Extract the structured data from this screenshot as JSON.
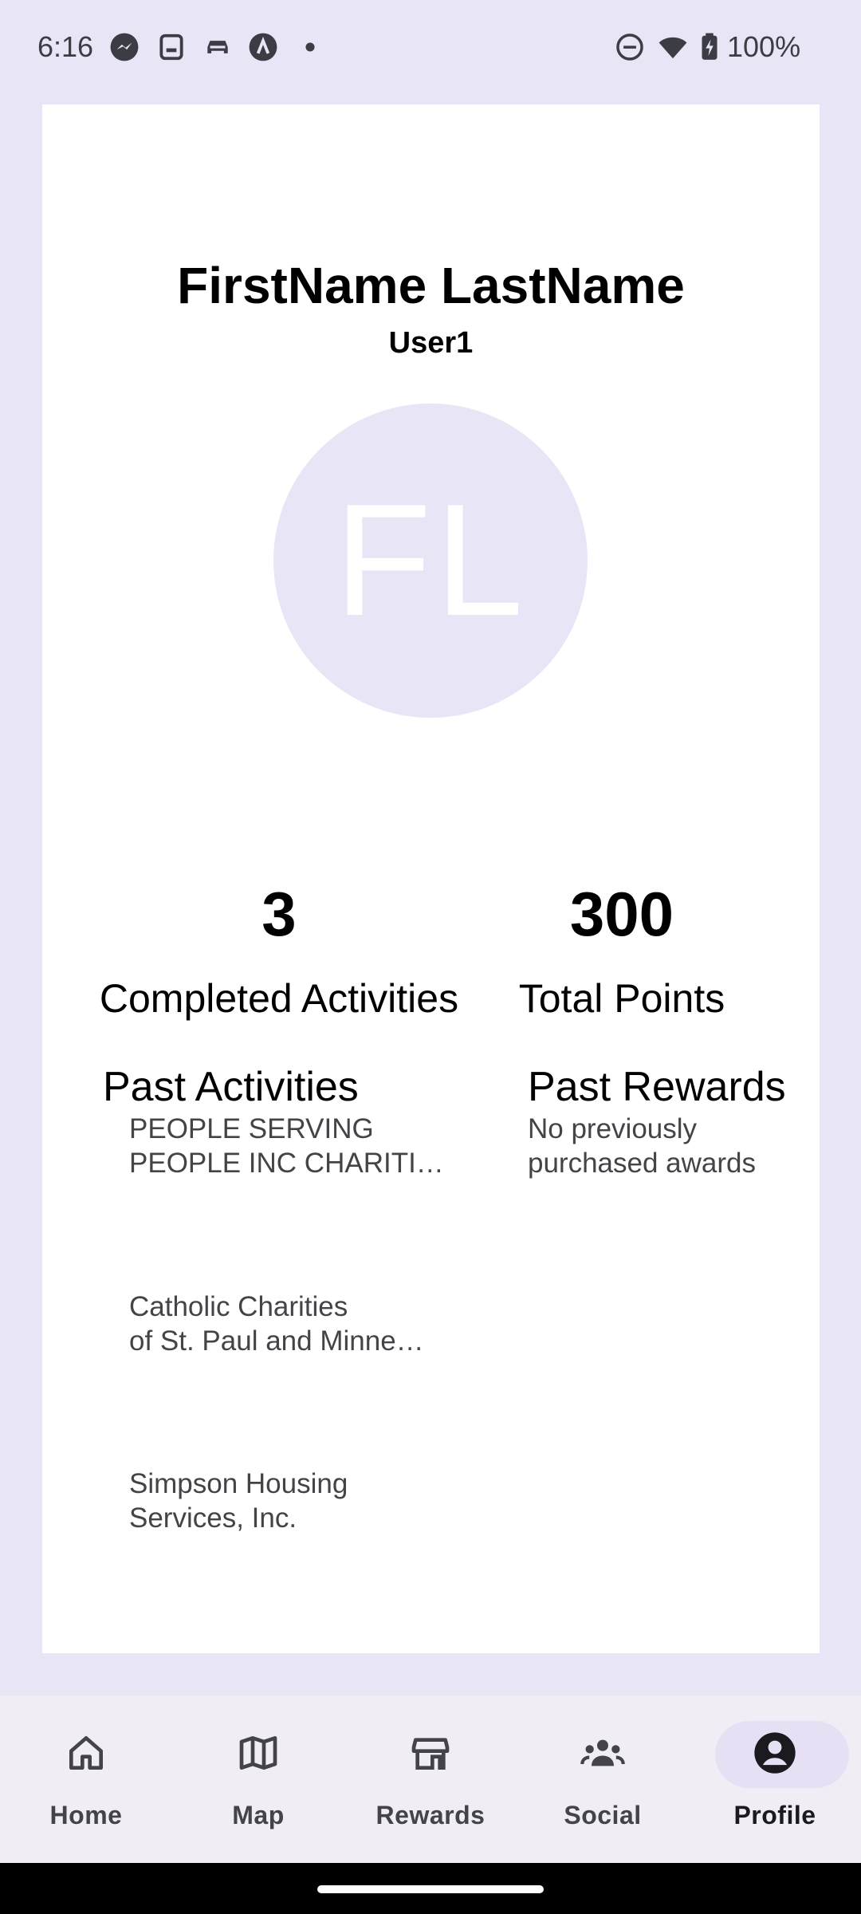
{
  "status_bar": {
    "time": "6:16",
    "battery_text": "100%",
    "icons_left": [
      "messenger-icon",
      "tablet-icon",
      "car-icon",
      "app-icon",
      "dot-icon"
    ],
    "icons_right": [
      "do-not-disturb-icon",
      "wifi-icon",
      "battery-charging-icon"
    ]
  },
  "profile": {
    "full_name": "FirstName LastName",
    "username": "User1",
    "initials": "FL",
    "avatar_color": "#e7e5f6"
  },
  "stats": {
    "completed_value": "3",
    "completed_label": "Completed Activities",
    "points_value": "300",
    "points_label": "Total Points"
  },
  "past_activities": {
    "heading": "Past Activities",
    "items": [
      {
        "line1": "PEOPLE SERVING",
        "line2": "PEOPLE INC CHARITI…"
      },
      {
        "line1": "Catholic Charities",
        "line2": "of St. Paul and Minne…"
      },
      {
        "line1": "Simpson Housing",
        "line2": "Services, Inc."
      }
    ]
  },
  "past_rewards": {
    "heading": "Past Rewards",
    "empty_line1": "No previously",
    "empty_line2": "purchased awards"
  },
  "nav": {
    "items": [
      {
        "label": "Home",
        "icon": "home-icon"
      },
      {
        "label": "Map",
        "icon": "map-icon"
      },
      {
        "label": "Rewards",
        "icon": "store-icon"
      },
      {
        "label": "Social",
        "icon": "group-icon"
      },
      {
        "label": "Profile",
        "icon": "account-circle-icon",
        "active": true
      }
    ]
  },
  "colors": {
    "background": "#e7e5f6",
    "nav_background": "#f1edf5",
    "active_pill": "#e7e0f4"
  }
}
